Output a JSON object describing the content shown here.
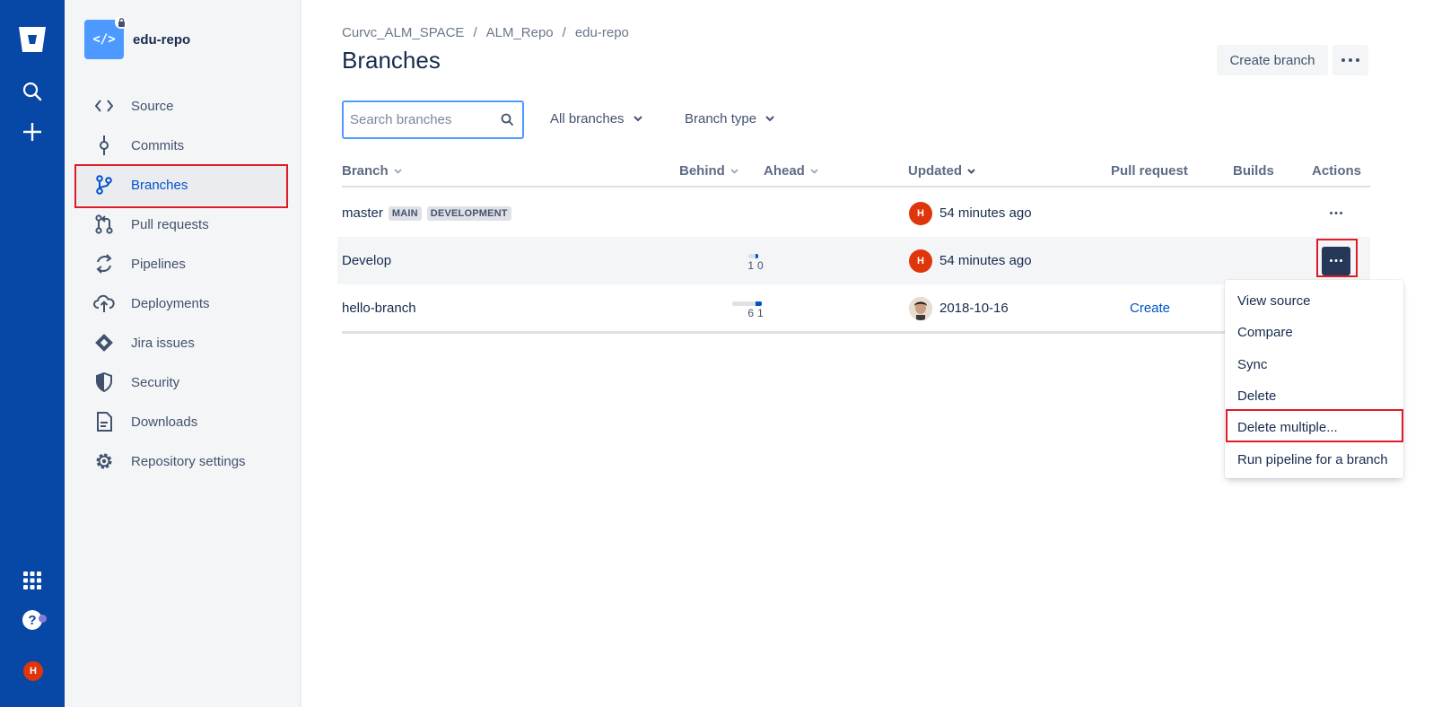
{
  "global_nav": {
    "icons": [
      "bitbucket-logo-icon",
      "search-icon",
      "create-plus-icon",
      "app-switcher-icon",
      "help-icon"
    ],
    "user_initial": "H"
  },
  "sidebar": {
    "repo_name": "edu-repo",
    "repo_icon_text": "</>",
    "items": [
      {
        "label": "Source",
        "icon": "source-code-icon"
      },
      {
        "label": "Commits",
        "icon": "commits-icon"
      },
      {
        "label": "Branches",
        "icon": "branches-icon",
        "active": true
      },
      {
        "label": "Pull requests",
        "icon": "pull-requests-icon"
      },
      {
        "label": "Pipelines",
        "icon": "pipelines-icon"
      },
      {
        "label": "Deployments",
        "icon": "deployments-icon"
      },
      {
        "label": "Jira issues",
        "icon": "jira-icon"
      },
      {
        "label": "Security",
        "icon": "shield-icon"
      },
      {
        "label": "Downloads",
        "icon": "downloads-icon"
      },
      {
        "label": "Repository settings",
        "icon": "gear-icon"
      }
    ]
  },
  "breadcrumb": [
    "Curvc_ALM_SPACE",
    "ALM_Repo",
    "edu-repo"
  ],
  "breadcrumb_sep": "/",
  "page_title": "Branches",
  "header_actions": {
    "create_branch": "Create branch"
  },
  "filters": {
    "search_placeholder": "Search branches",
    "search_value": "",
    "all_branches": "All branches",
    "branch_type": "Branch type"
  },
  "table": {
    "columns": {
      "branch": "Branch",
      "behind": "Behind",
      "ahead": "Ahead",
      "updated": "Updated",
      "pull_request": "Pull request",
      "builds": "Builds",
      "actions": "Actions"
    },
    "rows": [
      {
        "name": "master",
        "badges": [
          "MAIN",
          "DEVELOPMENT"
        ],
        "behind": null,
        "ahead": null,
        "updated": "54 minutes ago",
        "avatar": "H",
        "pull_request": ""
      },
      {
        "name": "Develop",
        "badges": [],
        "behind": "1",
        "ahead": "0",
        "updated": "54 minutes ago",
        "avatar": "H",
        "pull_request": ""
      },
      {
        "name": "hello-branch",
        "badges": [],
        "behind": "6",
        "ahead": "1",
        "updated": "2018-10-16",
        "avatar": "photo",
        "pull_request": "Create"
      }
    ]
  },
  "actions_menu": {
    "items": [
      "View source",
      "Compare",
      "Sync",
      "Delete",
      "Delete multiple...",
      "Run pipeline for a branch"
    ]
  },
  "colors": {
    "global_nav": "#0747a6",
    "accent": "#0052cc",
    "highlight": "#de1b28",
    "avatar": "#de350b"
  }
}
